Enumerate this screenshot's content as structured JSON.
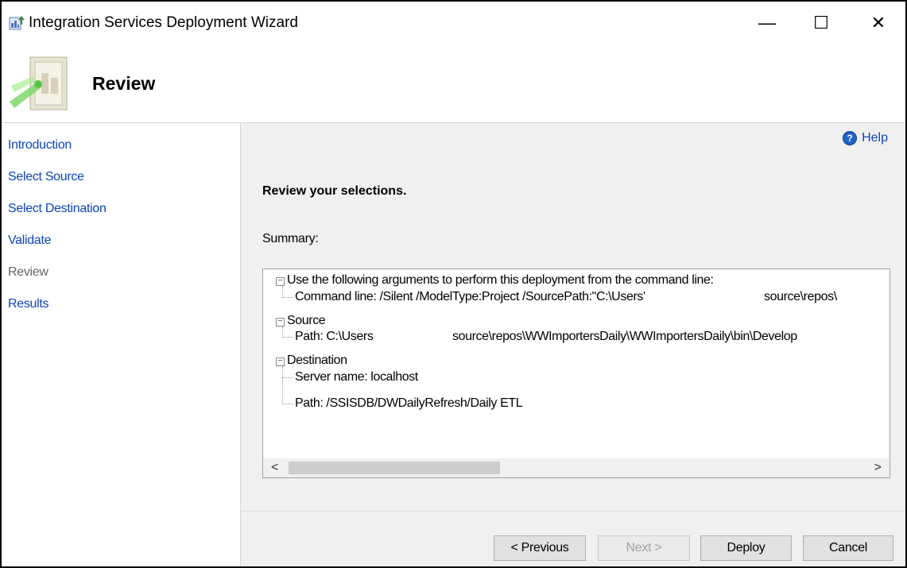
{
  "window": {
    "title": "Integration Services Deployment Wizard",
    "icon": "wizard-app-icon",
    "controls": {
      "minimize": "—",
      "maximize": "☐",
      "close": "✕"
    }
  },
  "header": {
    "title": "Review",
    "image": "wizard-banner-image"
  },
  "sidebar": {
    "items": [
      {
        "label": "Introduction",
        "state": "link"
      },
      {
        "label": "Select Source",
        "state": "link"
      },
      {
        "label": "Select Destination",
        "state": "link"
      },
      {
        "label": "Validate",
        "state": "link"
      },
      {
        "label": "Review",
        "state": "current"
      },
      {
        "label": "Results",
        "state": "link"
      }
    ]
  },
  "main": {
    "help_label": "Help",
    "help_icon": "help-icon",
    "heading": "Review your selections.",
    "summary_label": "Summary:",
    "tree": {
      "nodes": [
        {
          "label": "Use the following arguments to perform this deployment from the command line:",
          "expanded": true,
          "children": [
            {
              "label": "Command line: /Silent /ModelType:Project /SourcePath:\"C:\\Users'",
              "trailing": "source\\repos\\"
            }
          ]
        },
        {
          "label": "Source",
          "expanded": true,
          "children": [
            {
              "label": "Path: C:\\Users",
              "trailing": "source\\repos\\WWImportersDaily\\WWImportersDaily\\bin\\Develop"
            }
          ]
        },
        {
          "label": "Destination",
          "expanded": true,
          "children": [
            {
              "label": "Server name: localhost"
            },
            {
              "label": "Path: /SSISDB/DWDailyRefresh/Daily ETL"
            }
          ]
        }
      ],
      "scroll_left": "<",
      "scroll_right": ">"
    }
  },
  "footer": {
    "previous": "< Previous",
    "next": "Next >",
    "deploy": "Deploy",
    "cancel": "Cancel",
    "next_enabled": false
  },
  "colors": {
    "link": "#0b46b8",
    "panel": "#f0f0f0",
    "border": "#a0a0a0"
  }
}
